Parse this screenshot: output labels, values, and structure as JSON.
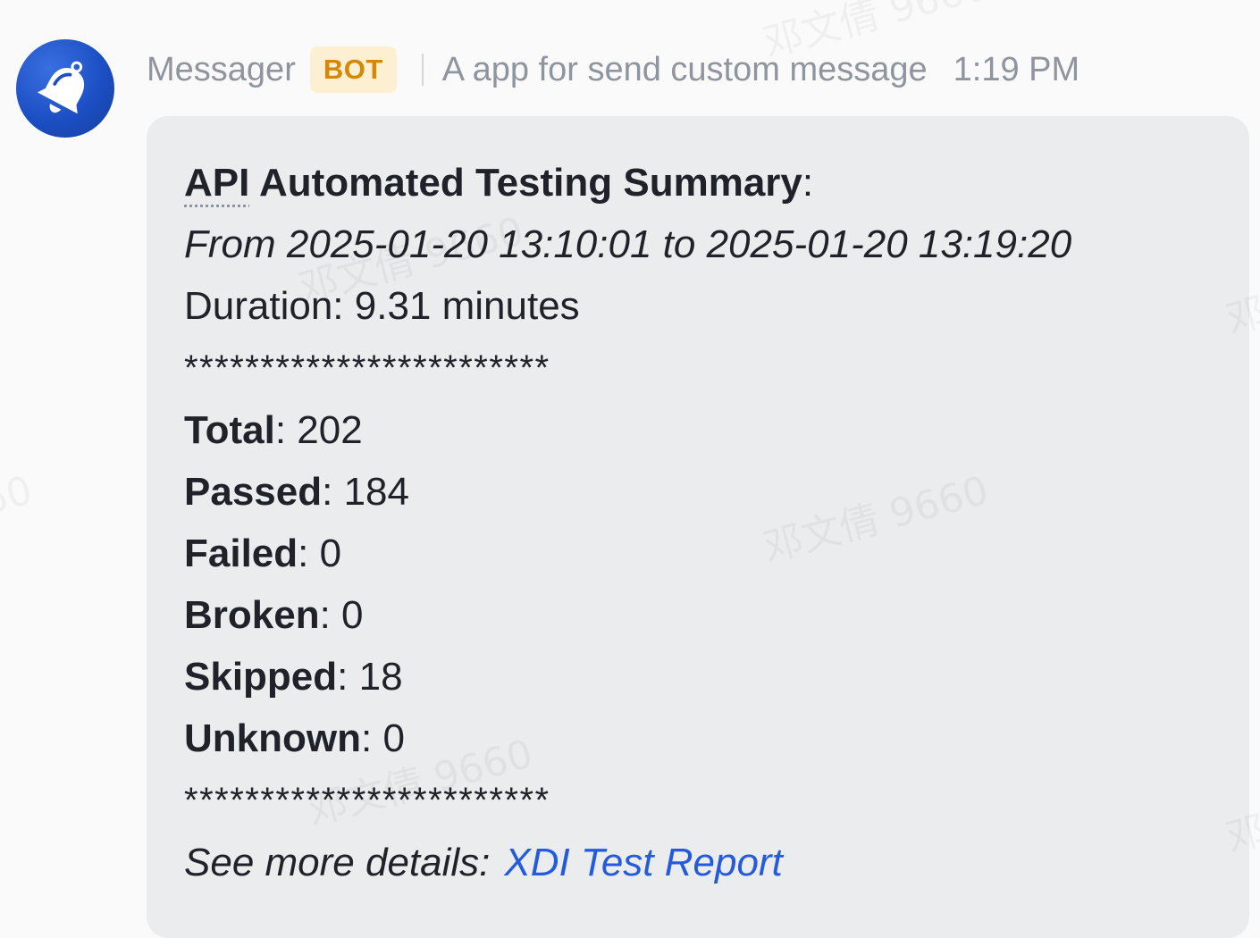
{
  "message": {
    "sender": "Messager",
    "badge": "BOT",
    "app_description": "A app for send custom message",
    "time": "1:19 PM",
    "avatar_icon": "bell-icon",
    "colors": {
      "avatar": "#1c4fc4",
      "badge_bg": "#fdf0d2",
      "badge_text": "#d48806",
      "card_bg": "#ebecee",
      "link": "#245bdb"
    }
  },
  "card": {
    "title_abbr": "API",
    "title_rest": " Automated Testing Summary",
    "title_colon": ":",
    "period": "From 2025-01-20 13:10:01 to 2025-01-20 13:19:20",
    "duration": "Duration: 9.31 minutes",
    "separator": "************************",
    "stats": [
      {
        "label": "Total",
        "value": "202"
      },
      {
        "label": "Passed",
        "value": "184"
      },
      {
        "label": "Failed",
        "value": "0"
      },
      {
        "label": "Broken",
        "value": "0"
      },
      {
        "label": "Skipped",
        "value": "18"
      },
      {
        "label": "Unknown",
        "value": "0"
      }
    ],
    "details_label": "See more details:",
    "details_link": "XDI Test Report"
  },
  "watermark": {
    "text": "邓文倩 9660"
  }
}
